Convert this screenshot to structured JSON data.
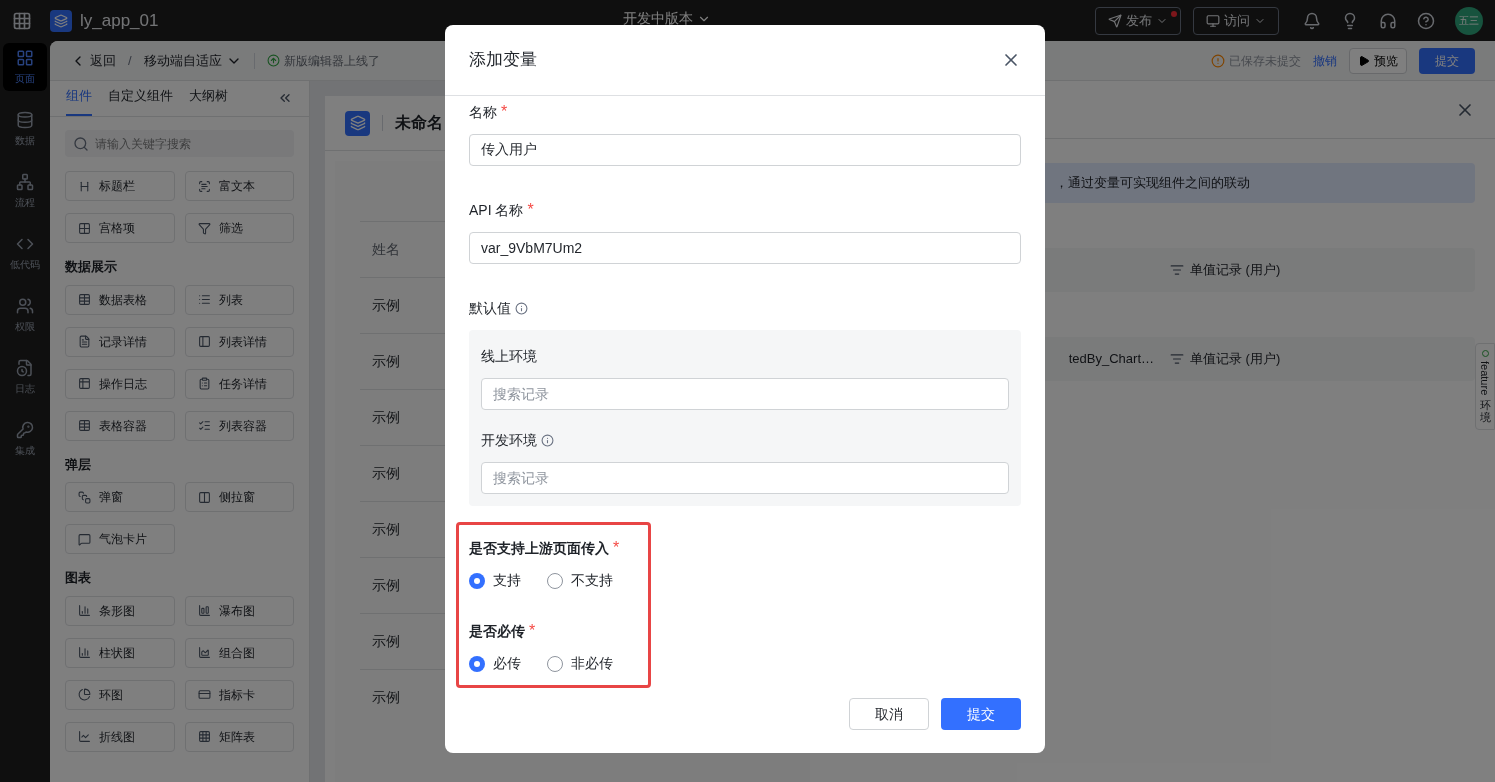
{
  "topbar": {
    "app_name": "ly_app_01",
    "version": "开发中版本",
    "publish": "发布",
    "publish_dot": true,
    "visit": "访问",
    "avatar": "五三"
  },
  "nav": [
    {
      "label": "页面",
      "selected": true
    },
    {
      "label": "数据",
      "selected": false
    },
    {
      "label": "流程",
      "selected": false
    },
    {
      "label": "低代码",
      "selected": false
    },
    {
      "label": "权限",
      "selected": false
    },
    {
      "label": "日志",
      "selected": false
    },
    {
      "label": "集成",
      "selected": false
    }
  ],
  "subbar": {
    "back": "返回",
    "separator": "/",
    "page": "移动端自适应",
    "notice": "新版编辑器上线了",
    "status": "已保存未提交",
    "undo": "撤销",
    "preview": "预览",
    "submit": "提交"
  },
  "panel_tabs": [
    {
      "label": "组件",
      "selected": true
    },
    {
      "label": "自定义组件",
      "selected": false
    },
    {
      "label": "大纲树",
      "selected": false
    }
  ],
  "component_search": {
    "placeholder": "请输入关键字搜索"
  },
  "component_groups": [
    {
      "items": [
        "标题栏",
        "富文本",
        "宫格项",
        "筛选"
      ]
    },
    {
      "title": "数据展示",
      "items": [
        "数据表格",
        "列表",
        "记录详情",
        "列表详情",
        "操作日志",
        "任务详情",
        "表格容器",
        "列表容器"
      ]
    },
    {
      "title": "弹层",
      "items": [
        "弹窗",
        "侧拉窗",
        "气泡卡片"
      ]
    },
    {
      "title": "图表",
      "items": [
        "条形图",
        "瀑布图",
        "柱状图",
        "组合图",
        "环图",
        "指标卡",
        "折线图",
        "矩阵表"
      ]
    }
  ],
  "canvas": {
    "page_title": "未命名",
    "column": "姓名",
    "rows": [
      "示例",
      "示例",
      "示例",
      "示例",
      "示例",
      "示例",
      "示例",
      "示例"
    ]
  },
  "drawer": {
    "banner": "，通过变量可实现组件之间的联动",
    "rows": [
      {
        "type": "单值记录 (用户)"
      },
      {
        "name": "tedBy_Chart…",
        "type": "单值记录 (用户)"
      }
    ]
  },
  "feature_tab": {
    "label": "feature",
    "env": "环境"
  },
  "modal": {
    "title": "添加变量",
    "name_field": {
      "label": "名称",
      "required": true,
      "value": "传入用户"
    },
    "api_field": {
      "label": "API 名称",
      "required": true,
      "value": "var_9VbM7Um2"
    },
    "default_value": {
      "label": "默认值",
      "online": {
        "label": "线上环境",
        "placeholder": "搜索记录"
      },
      "dev": {
        "label": "开发环境",
        "placeholder": "搜索记录"
      }
    },
    "radio_groups": [
      {
        "label": "是否支持上游页面传入",
        "required": true,
        "options": [
          {
            "label": "支持",
            "selected": true
          },
          {
            "label": "不支持",
            "selected": false
          }
        ]
      },
      {
        "label": "是否必传",
        "required": true,
        "options": [
          {
            "label": "必传",
            "selected": true
          },
          {
            "label": "非必传",
            "selected": false
          }
        ]
      }
    ],
    "required_mark": "*",
    "highlighted": true,
    "cancel": "取消",
    "submit": "提交"
  }
}
